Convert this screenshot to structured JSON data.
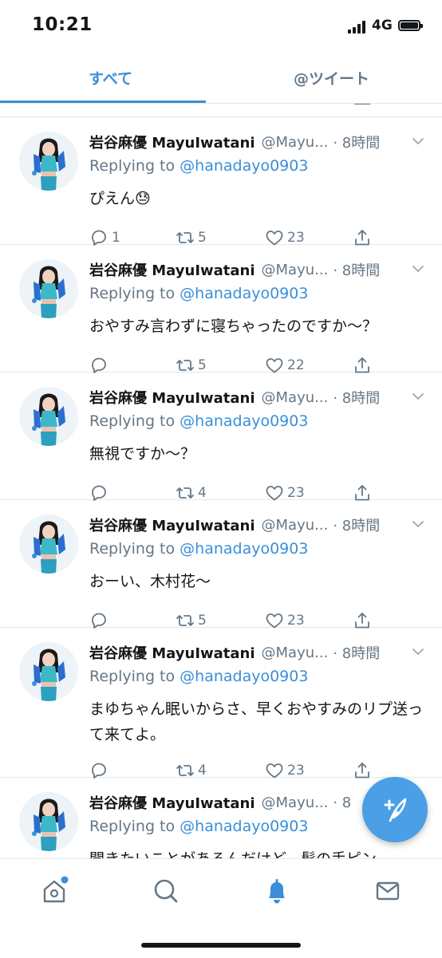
{
  "status_bar": {
    "time": "10:21",
    "network": "4G"
  },
  "tabs": [
    {
      "label": "すべて",
      "active": true
    },
    {
      "label": "@ツイート",
      "active": false
    }
  ],
  "colors": {
    "accent": "#3a8fd8",
    "muted": "#657786",
    "text": "#14171a",
    "fab": "#4a9fe6"
  },
  "tweets": [
    {
      "name": "岩谷麻優 MayuIwatani",
      "handle": "@Mayu...",
      "time": "· 8時間",
      "reply_prefix": "Replying to ",
      "reply_to": "@hanadayo0903",
      "text": "ぴえん😓",
      "replies": "1",
      "retweets": "5",
      "likes": "23"
    },
    {
      "name": "岩谷麻優 MayuIwatani",
      "handle": "@Mayu...",
      "time": "· 8時間",
      "reply_prefix": "Replying to ",
      "reply_to": "@hanadayo0903",
      "text": "おやすみ言わずに寝ちゃったのですか〜？",
      "replies": "",
      "retweets": "5",
      "likes": "22"
    },
    {
      "name": "岩谷麻優 MayuIwatani",
      "handle": "@Mayu...",
      "time": "· 8時間",
      "reply_prefix": "Replying to ",
      "reply_to": "@hanadayo0903",
      "text": "無視ですか〜？",
      "replies": "",
      "retweets": "4",
      "likes": "23"
    },
    {
      "name": "岩谷麻優 MayuIwatani",
      "handle": "@Mayu...",
      "time": "· 8時間",
      "reply_prefix": "Replying to ",
      "reply_to": "@hanadayo0903",
      "text": "おーい、木村花〜",
      "replies": "",
      "retweets": "5",
      "likes": "23"
    },
    {
      "name": "岩谷麻優 MayuIwatani",
      "handle": "@Mayu...",
      "time": "· 8時間",
      "reply_prefix": "Replying to ",
      "reply_to": "@hanadayo0903",
      "text": "まゆちゃん眠いからさ、早くおやすみのリプ送って来てよ。",
      "replies": "",
      "retweets": "4",
      "likes": "23"
    },
    {
      "name": "岩谷麻優 MayuIwatani",
      "handle": "@Mayu...",
      "time": "· 8",
      "reply_prefix": "Replying to ",
      "reply_to": "@hanadayo0903",
      "text": "聞きたいことがあるんだけど、髪の手ピン",
      "replies": "",
      "retweets": "",
      "likes": ""
    }
  ],
  "bottom_nav": [
    {
      "icon": "home-icon",
      "active": false,
      "has_dot": true
    },
    {
      "icon": "search-icon",
      "active": false
    },
    {
      "icon": "notifications-bell-icon",
      "active": true
    },
    {
      "icon": "messages-icon",
      "active": false
    }
  ],
  "fab": {
    "icon": "compose-tweet-icon"
  }
}
